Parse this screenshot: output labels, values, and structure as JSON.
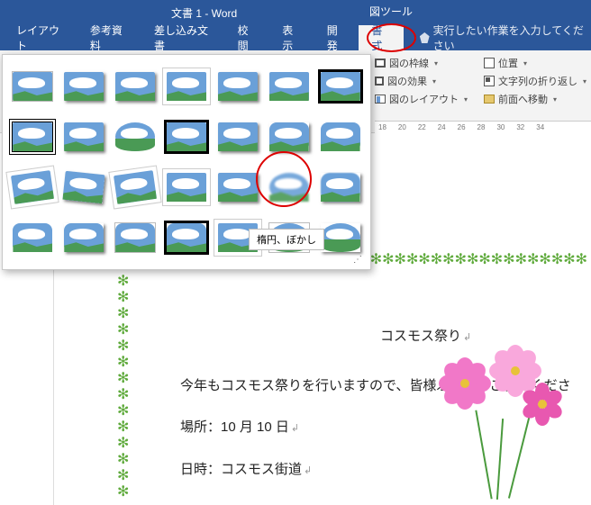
{
  "title": {
    "doc": "文書 1  -  Word",
    "tool": "図ツール"
  },
  "tabs": {
    "layout": "レイアウト",
    "ref": "参考資料",
    "mail": "差し込み文書",
    "review": "校閲",
    "view": "表示",
    "dev": "開発",
    "format": "書式",
    "tellme": "実行したい作業を入力してください"
  },
  "ribbon": {
    "frame": "図の枠線",
    "effect": "図の効果",
    "layout": "図のレイアウト",
    "pos": "位置",
    "wrap": "文字列の折り返し",
    "front": "前面へ移動"
  },
  "ruler": [
    "18",
    "20",
    "22",
    "24",
    "26",
    "28",
    "30",
    "32",
    "34"
  ],
  "gallery": {
    "tooltip": "楕円、ぼかし"
  },
  "doc": {
    "heading": "コスモス祭り",
    "p1": "今年もコスモス祭りを行いますので、皆様ふるってご参加くださ",
    "p2": "場所：10 月 10 日",
    "p3": "日時：コスモス街道"
  }
}
